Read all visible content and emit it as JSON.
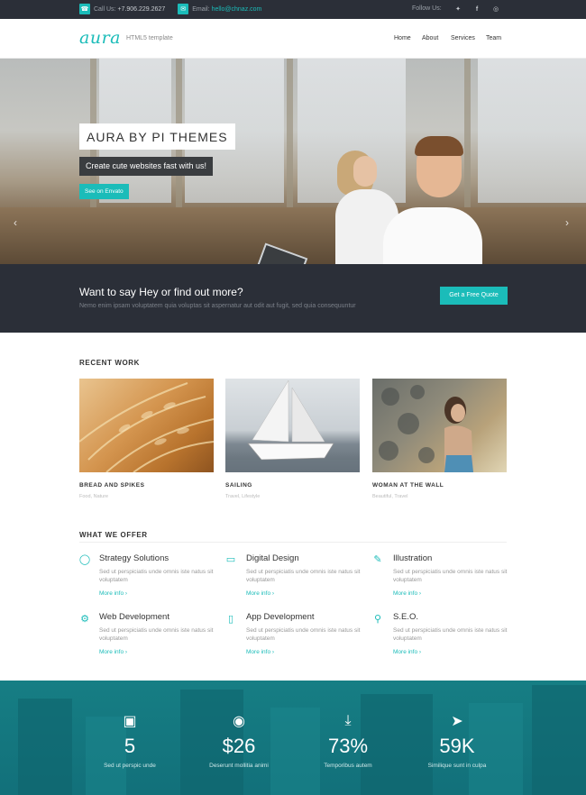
{
  "topbar": {
    "phone_label": "Call Us:",
    "phone": "+7.906.229.2627",
    "email_label": "Email:",
    "email": "hello@chnaz.com",
    "follow_label": "Follow Us:"
  },
  "header": {
    "logo": "aura",
    "tagline": "HTML5 template",
    "nav": [
      "Home",
      "About",
      "Services",
      "Team"
    ]
  },
  "hero": {
    "title": "AURA BY PI THEMES",
    "subtitle": "Create cute websites fast with us!",
    "button": "See on Envato",
    "slides": 2,
    "active_slide": 1
  },
  "cta": {
    "heading": "Want to say Hey or find out more?",
    "text": "Nemo enim ipsam voluptatem quia voluptas sit aspernatur aut odit aut fugit, sed quia consequuntur",
    "button": "Get a Free Quote"
  },
  "recent_work": {
    "title": "RECENT WORK",
    "items": [
      {
        "title": "BREAD AND SPIKES",
        "meta": "Food, Nature"
      },
      {
        "title": "SAILING",
        "meta": "Travel, Lifestyle"
      },
      {
        "title": "WOMAN AT THE WALL",
        "meta": "Beautiful, Travel"
      }
    ]
  },
  "offer": {
    "title": "WHAT WE OFFER",
    "items": [
      {
        "title": "Strategy Solutions",
        "text": "Sed ut perspiciatis unde omnis iste natus sit voluptatem",
        "more": "More info ›",
        "icon": "lightbulb-icon"
      },
      {
        "title": "Digital Design",
        "text": "Sed ut perspiciatis unde omnis iste natus sit voluptatem",
        "more": "More info ›",
        "icon": "monitor-icon"
      },
      {
        "title": "Illustration",
        "text": "Sed ut perspiciatis unde omnis iste natus sit voluptatem",
        "more": "More info ›",
        "icon": "pencil-icon"
      },
      {
        "title": "Web Development",
        "text": "Sed ut perspiciatis unde omnis iste natus sit voluptatem",
        "more": "More info ›",
        "icon": "gear-icon"
      },
      {
        "title": "App Development",
        "text": "Sed ut perspiciatis unde omnis iste natus sit voluptatem",
        "more": "More info ›",
        "icon": "mobile-icon"
      },
      {
        "title": "S.E.O.",
        "text": "Sed ut perspiciatis unde omnis iste natus sit voluptatem",
        "more": "More info ›",
        "icon": "search-icon"
      }
    ]
  },
  "stats": [
    {
      "value": "5",
      "label": "Sed ut perspic unde",
      "icon": "briefcase-icon"
    },
    {
      "value": "$26",
      "label": "Deserunt mollitia animi",
      "icon": "globe-icon"
    },
    {
      "value": "73%",
      "label": "Temporibus autem",
      "icon": "download-icon"
    },
    {
      "value": "59K",
      "label": "Similique sunt in culpa",
      "icon": "paper-plane-icon"
    }
  ],
  "colors": {
    "accent": "#1bbcb9",
    "dark": "#2b2f38",
    "stats_bg": "#167e84"
  }
}
